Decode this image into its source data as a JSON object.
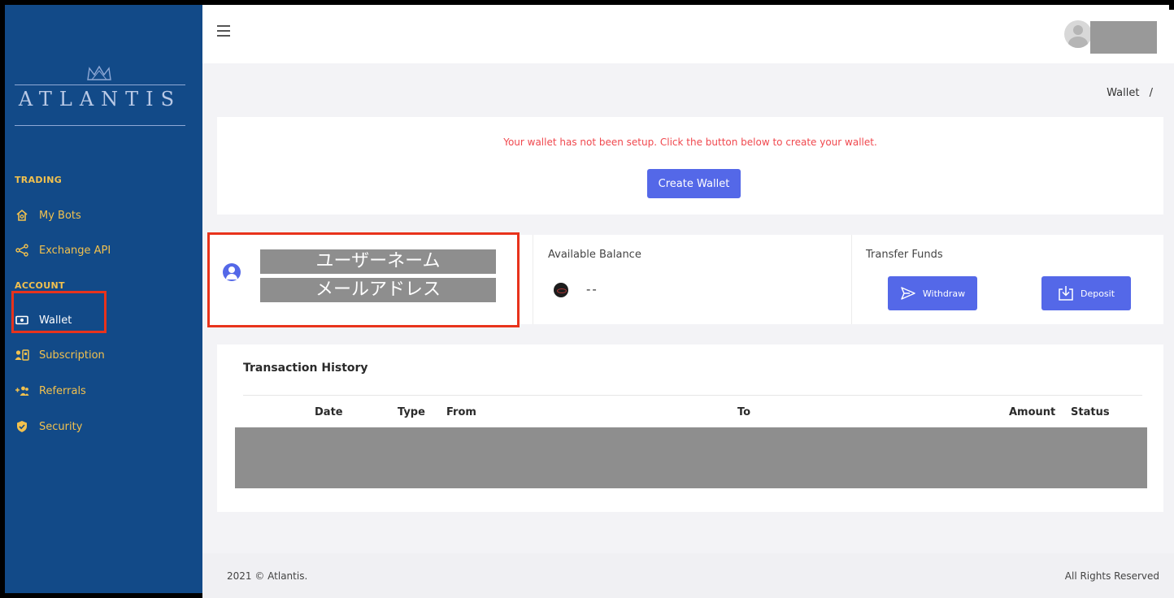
{
  "brand": {
    "name": "ATLANTIS"
  },
  "sidebar": {
    "sections": [
      {
        "label": "TRADING"
      },
      {
        "label": "ACCOUNT"
      }
    ],
    "items": [
      {
        "label": "My Bots",
        "icon": "home-icon"
      },
      {
        "label": "Exchange API",
        "icon": "share-icon"
      },
      {
        "label": "Wallet",
        "icon": "wallet-icon"
      },
      {
        "label": "Subscription",
        "icon": "subscription-icon"
      },
      {
        "label": "Referrals",
        "icon": "add-users-icon"
      },
      {
        "label": "Security",
        "icon": "shield-icon"
      }
    ],
    "active_item": "Wallet"
  },
  "breadcrumb": {
    "current": "Wallet",
    "separator": "/"
  },
  "notice": {
    "message": "Your wallet has not been setup. Click the button below to create your wallet.",
    "button_label": "Create Wallet"
  },
  "user": {
    "username": "ユーザーネーム",
    "email": "メールアドレス"
  },
  "balance": {
    "label": "Available Balance",
    "value": "--"
  },
  "transfer": {
    "label": "Transfer Funds",
    "withdraw_label": "Withdraw",
    "deposit_label": "Deposit"
  },
  "history": {
    "title": "Transaction History",
    "columns": [
      "Date",
      "Type",
      "From",
      "To",
      "Amount",
      "Status"
    ]
  },
  "footer": {
    "copyright": "2021 © Atlantis.",
    "rights": "All Rights Reserved"
  },
  "colors": {
    "sidebar_bg": "#124a88",
    "accent": "#5468e8",
    "nav_text": "#f2c14e",
    "alert_text": "#f0484e",
    "highlight_box": "#e8331c"
  }
}
